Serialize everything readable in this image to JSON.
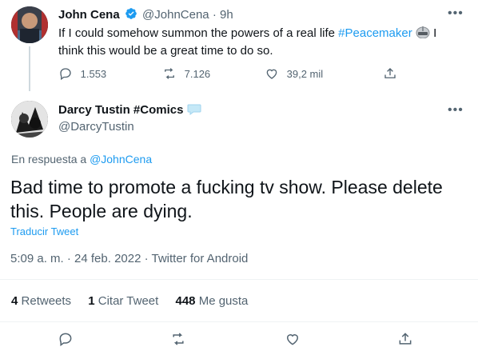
{
  "parent_tweet": {
    "author_name": "John Cena",
    "handle": "@JohnCena",
    "separator": "·",
    "time": "9h",
    "text_before": "If I could somehow summon the powers of a real life ",
    "hashtag": "#Peacemaker",
    "text_after_line1": " I",
    "text_line2": "think this would be a great time to do so.",
    "replies": "1.553",
    "retweets": "7.126",
    "likes": "39,2 mil"
  },
  "main_tweet": {
    "author_name": "Darcy Tustin #Comics",
    "handle": "@DarcyTustin",
    "reply_prefix": "En respuesta a ",
    "reply_to": "@JohnCena",
    "text_line1": "Bad time to promote a fucking tv show. Please delete",
    "text_line2": "this. People are dying.",
    "translate": "Traducir Tweet",
    "timestamp": "5:09 a. m. · 24 feb. 2022 · Twitter for Android"
  },
  "engagement": {
    "retweets_count": "4",
    "retweets_label": "Retweets",
    "quotes_count": "1",
    "quotes_label": "Citar Tweet",
    "likes_count": "448",
    "likes_label": "Me gusta"
  },
  "colors": {
    "accent": "#1d9bf0",
    "text": "#0f1419",
    "muted": "#536471",
    "divider": "#eff3f4"
  }
}
